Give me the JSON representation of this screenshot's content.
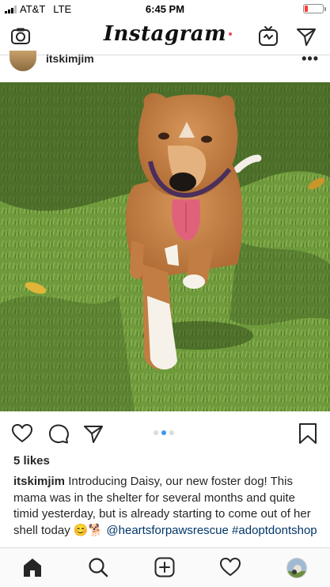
{
  "status": {
    "carrier": "AT&T",
    "network": "LTE",
    "time": "6:45 PM",
    "battery_level": 0.15
  },
  "header": {
    "logo_text": "Instagram",
    "icons": [
      "camera-icon",
      "igtv-icon",
      "direct-message-icon"
    ]
  },
  "post": {
    "username": "itskimjim",
    "more_label": "•••",
    "carousel": {
      "count": 3,
      "active": 1
    },
    "likes": "5 likes",
    "caption": {
      "username": "itskimjim",
      "text": " Introducing Daisy, our new foster dog! This mama was in the shelter for several months and quite timid yesterday, but is already starting to come out of her shell today 😊🐕 ",
      "mention": "@heartsforpawsrescue",
      "hashtag": "#adoptdontshop"
    }
  },
  "nav": {
    "items": [
      "home-icon",
      "search-icon",
      "new-post-icon",
      "activity-icon",
      "profile-avatar"
    ],
    "active": "home-icon"
  },
  "colors": {
    "link": "#003569",
    "carousel_active": "#3897f0",
    "notification": "#ed4956",
    "battery_low": "#ff3b30"
  }
}
